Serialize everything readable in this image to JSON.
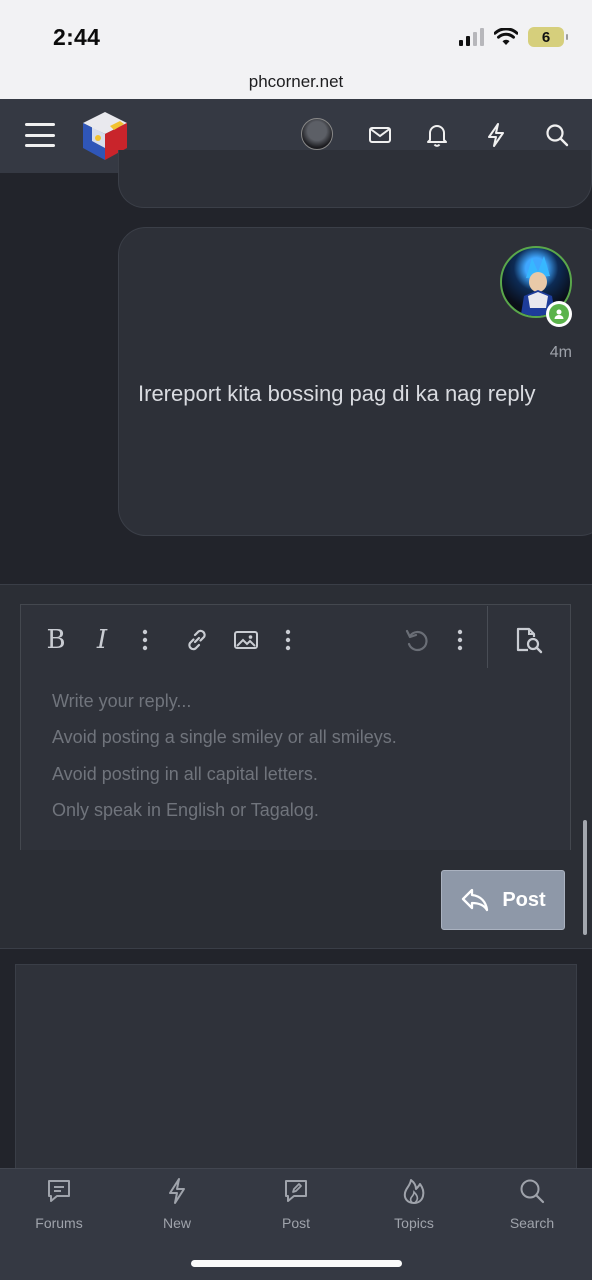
{
  "status_bar": {
    "time": "2:44",
    "battery": "6",
    "url": "phcorner.net"
  },
  "header": {
    "icons": [
      "menu-icon",
      "site-logo",
      "user-avatar",
      "mail-icon",
      "bell-icon",
      "bolt-icon",
      "search-icon"
    ]
  },
  "message": {
    "time": "4m",
    "text": "Irereport kita bossing pag di ka nag reply"
  },
  "editor": {
    "toolbar": [
      "bold-icon",
      "italic-icon",
      "more-icon",
      "link-icon",
      "image-icon",
      "more-icon",
      "undo-icon",
      "more-icon",
      "preview-icon"
    ],
    "bold_label": "B",
    "italic_label": "I",
    "placeholder_lines": [
      "Write your reply...",
      "Avoid posting a single smiley or all smileys.",
      "Avoid posting in all capital letters.",
      "Only speak in English or Tagalog."
    ],
    "post_label": "Post"
  },
  "bottom_nav": {
    "items": [
      {
        "label": "Forums",
        "icon": "forums-icon"
      },
      {
        "label": "New",
        "icon": "bolt-icon"
      },
      {
        "label": "Post",
        "icon": "post-icon"
      },
      {
        "label": "Topics",
        "icon": "flame-icon"
      },
      {
        "label": "Search",
        "icon": "search-icon"
      }
    ]
  },
  "colors": {
    "background": "#22242b",
    "header": "#353943",
    "post_button": "#8e98a8",
    "online": "#5ab34b"
  }
}
